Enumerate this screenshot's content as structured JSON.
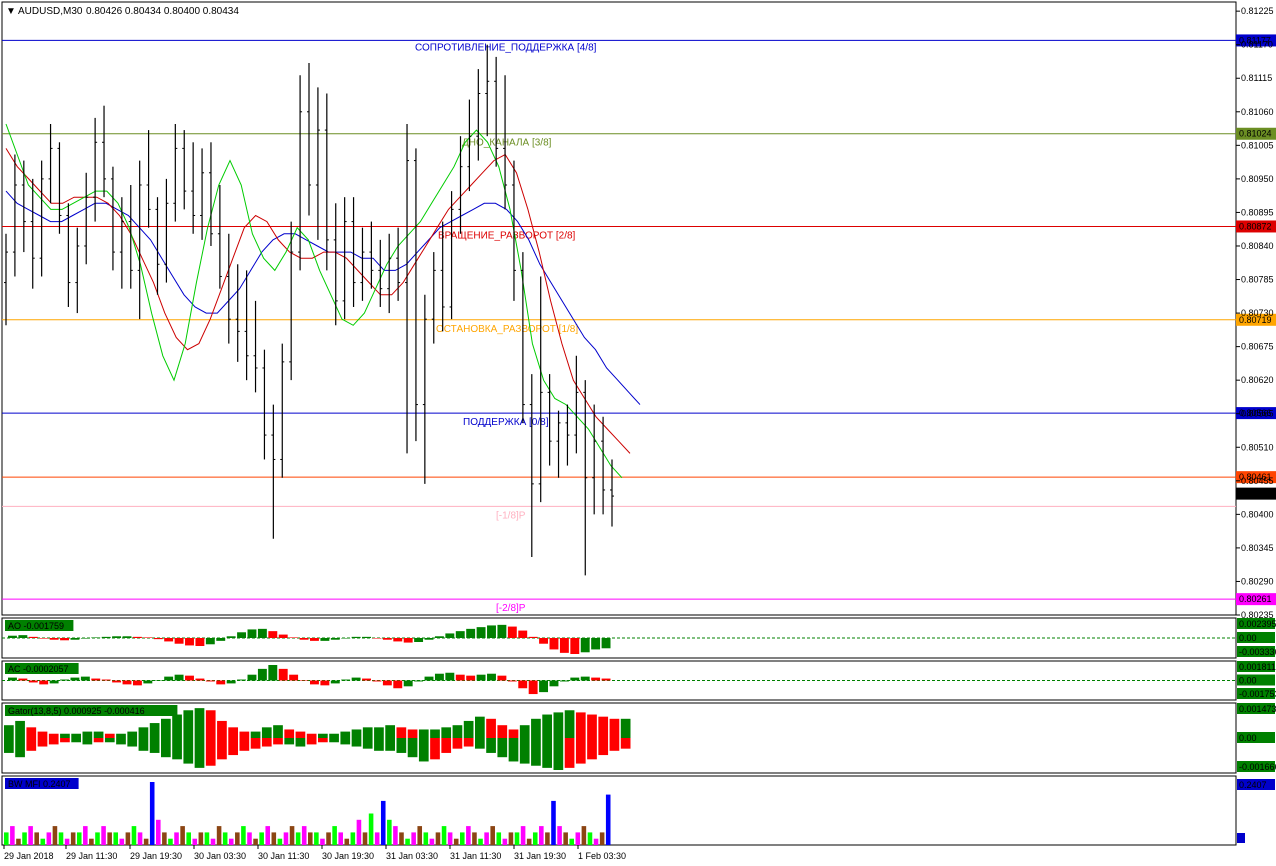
{
  "header": {
    "symbol_tf": "AUDUSD,M30",
    "ohlc": "0.80426 0.80434 0.80400 0.80434"
  },
  "colors": {
    "frame": "#000000",
    "candle": "#000000",
    "jaw": "#0000cc",
    "teeth": "#cc0000",
    "lips": "#00cc00",
    "up_bar": "#008000",
    "down_bar": "#ff0000",
    "fractal": "#000000"
  },
  "chart_data": [
    {
      "type": "candlestick",
      "name": "main",
      "ylim": [
        0.80235,
        0.8124
      ],
      "y_ticks": [
        "0.81225",
        "0.81170",
        "0.81115",
        "0.81060",
        "0.81005",
        "0.80950",
        "0.80895",
        "0.80840",
        "0.80785",
        "0.80730",
        "0.80675",
        "0.80620",
        "0.80565",
        "0.80510",
        "0.80455",
        "0.80400",
        "0.80345",
        "0.80290",
        "0.80235"
      ],
      "x_ticks": [
        "29 Jan 2018",
        "29 Jan 11:30",
        "29 Jan 19:30",
        "30 Jan 03:30",
        "30 Jan 11:30",
        "30 Jan 19:30",
        "31 Jan 03:30",
        "31 Jan 11:30",
        "31 Jan 19:30",
        "1 Feb 03:30"
      ],
      "current_price": "0.80434",
      "murrey_levels": [
        {
          "label": "СОПРОТИВЛЕНИЕ_ПОДДЕРЖКА [4/8]",
          "value": 0.81177,
          "price": "0.81177",
          "color": "#0000cc"
        },
        {
          "label": "ДНО_КАНАЛА [3/8]",
          "value": 0.81024,
          "price": "0.81024",
          "color": "#6b8e23"
        },
        {
          "label": "ВРАЩЕНИЕ_РАЗВОРОТ [2/8]",
          "value": 0.80872,
          "price": "0.80872",
          "color": "#dd0000"
        },
        {
          "label": "ОСТАНОВКА_РАЗВОРОТ [1/8]",
          "value": 0.80719,
          "price": "0.80719",
          "color": "#ffa500"
        },
        {
          "label": "ПОДДЕРЖКА [0/8]",
          "value": 0.80566,
          "price": "0.80566",
          "color": "#0000cc"
        },
        {
          "label": "",
          "value": 0.80461,
          "price": "0.80461",
          "color": "#ff4500"
        },
        {
          "label": "[-1/8]P",
          "value": 0.80413,
          "price": "",
          "color": "#ffb0c0"
        },
        {
          "label": "[-2/8]P",
          "value": 0.80261,
          "price": "0.80261",
          "color": "#ff00ff"
        }
      ],
      "candles": [
        [
          0.8078,
          0.8086,
          0.8071,
          0.8083
        ],
        [
          0.8083,
          0.8099,
          0.8079,
          0.8094
        ],
        [
          0.8094,
          0.8098,
          0.8083,
          0.8088
        ],
        [
          0.8088,
          0.8095,
          0.8077,
          0.8082
        ],
        [
          0.8082,
          0.8098,
          0.8079,
          0.8095
        ],
        [
          0.8095,
          0.8104,
          0.8091,
          0.81
        ],
        [
          0.81,
          0.8101,
          0.8086,
          0.8089
        ],
        [
          0.8089,
          0.8091,
          0.8074,
          0.8078
        ],
        [
          0.8078,
          0.8087,
          0.8073,
          0.8084
        ],
        [
          0.8084,
          0.8096,
          0.8081,
          0.8092
        ],
        [
          0.8092,
          0.8105,
          0.8088,
          0.8101
        ],
        [
          0.8101,
          0.8107,
          0.8092,
          0.8095
        ],
        [
          0.8095,
          0.8097,
          0.808,
          0.8083
        ],
        [
          0.8083,
          0.8092,
          0.8077,
          0.8088
        ],
        [
          0.8088,
          0.8094,
          0.8077,
          0.808
        ],
        [
          0.808,
          0.8098,
          0.8072,
          0.8094
        ],
        [
          0.8094,
          0.8103,
          0.8087,
          0.809
        ],
        [
          0.809,
          0.8092,
          0.8076,
          0.8081
        ],
        [
          0.8081,
          0.8095,
          0.8078,
          0.8091
        ],
        [
          0.8091,
          0.8104,
          0.8088,
          0.81
        ],
        [
          0.81,
          0.8103,
          0.809,
          0.8093
        ],
        [
          0.8093,
          0.8101,
          0.8086,
          0.8089
        ],
        [
          0.8089,
          0.81,
          0.8085,
          0.8096
        ],
        [
          0.8096,
          0.8101,
          0.8084,
          0.8086
        ],
        [
          0.8086,
          0.8094,
          0.8077,
          0.8079
        ],
        [
          0.8079,
          0.8086,
          0.8068,
          0.8072
        ],
        [
          0.8072,
          0.8081,
          0.8065,
          0.807
        ],
        [
          0.807,
          0.808,
          0.8062,
          0.8066
        ],
        [
          0.8066,
          0.8075,
          0.806,
          0.8064
        ],
        [
          0.8064,
          0.8067,
          0.8049,
          0.8053
        ],
        [
          0.8053,
          0.8058,
          0.8036,
          0.8049
        ],
        [
          0.8049,
          0.8068,
          0.8046,
          0.8065
        ],
        [
          0.8065,
          0.8088,
          0.8062,
          0.8083
        ],
        [
          0.8083,
          0.8112,
          0.808,
          0.8106
        ],
        [
          0.8106,
          0.8114,
          0.8089,
          0.8094
        ],
        [
          0.8094,
          0.811,
          0.8085,
          0.8103
        ],
        [
          0.8103,
          0.8109,
          0.808,
          0.8085
        ],
        [
          0.8085,
          0.8091,
          0.8071,
          0.8075
        ],
        [
          0.8075,
          0.8092,
          0.8072,
          0.8088
        ],
        [
          0.8088,
          0.8092,
          0.8074,
          0.8078
        ],
        [
          0.8078,
          0.8087,
          0.8075,
          0.8083
        ],
        [
          0.8083,
          0.8088,
          0.8077,
          0.808
        ],
        [
          0.808,
          0.8085,
          0.8074,
          0.8077
        ],
        [
          0.8077,
          0.8086,
          0.8073,
          0.8082
        ],
        [
          0.8082,
          0.8087,
          0.8075,
          0.8078
        ],
        [
          0.8078,
          0.8104,
          0.805,
          0.8098
        ],
        [
          0.8098,
          0.81,
          0.8052,
          0.8058
        ],
        [
          0.8058,
          0.8076,
          0.8045,
          0.8072
        ],
        [
          0.8072,
          0.8083,
          0.8068,
          0.808
        ],
        [
          0.808,
          0.8088,
          0.807,
          0.8074
        ],
        [
          0.8074,
          0.8093,
          0.8072,
          0.809
        ],
        [
          0.809,
          0.8102,
          0.8086,
          0.8097
        ],
        [
          0.8097,
          0.8108,
          0.8093,
          0.8102
        ],
        [
          0.8102,
          0.8113,
          0.8098,
          0.8109
        ],
        [
          0.8109,
          0.8117,
          0.8102,
          0.8111
        ],
        [
          0.8111,
          0.8115,
          0.8097,
          0.81
        ],
        [
          0.81,
          0.8112,
          0.809,
          0.8094
        ],
        [
          0.8094,
          0.8098,
          0.8075,
          0.808
        ],
        [
          0.808,
          0.8083,
          0.8055,
          0.8058
        ],
        [
          0.8058,
          0.8063,
          0.8033,
          0.8045
        ],
        [
          0.8045,
          0.8079,
          0.8042,
          0.806
        ],
        [
          0.806,
          0.8063,
          0.8048,
          0.8052
        ],
        [
          0.8052,
          0.8057,
          0.8046,
          0.8055
        ],
        [
          0.8055,
          0.8058,
          0.8048,
          0.8053
        ],
        [
          0.8053,
          0.8066,
          0.805,
          0.806
        ],
        [
          0.806,
          0.8062,
          0.803,
          0.8046
        ],
        [
          0.8046,
          0.8058,
          0.804,
          0.8052
        ],
        [
          0.8052,
          0.8056,
          0.804,
          0.8044
        ],
        [
          0.8044,
          0.8049,
          0.8038,
          0.8043
        ]
      ],
      "alligator": {
        "jaw": [
          0.8093,
          0.8091,
          0.809,
          0.8089,
          0.8088,
          0.8088,
          0.8089,
          0.809,
          0.8091,
          0.8091,
          0.809,
          0.8089,
          0.8087,
          0.8085,
          0.8082,
          0.8079,
          0.8076,
          0.8074,
          0.8073,
          0.8073,
          0.8075,
          0.8077,
          0.808,
          0.8083,
          0.8085,
          0.8086,
          0.8086,
          0.8085,
          0.8084,
          0.8083,
          0.8083,
          0.8083,
          0.8082,
          0.8082,
          0.808,
          0.808,
          0.8081,
          0.8083,
          0.8085,
          0.8087,
          0.8088,
          0.8089,
          0.809,
          0.8091,
          0.8091,
          0.809,
          0.8088,
          0.8085,
          0.8081,
          0.8078,
          0.8075,
          0.8072,
          0.8069,
          0.8067,
          0.8064,
          0.8062,
          0.806,
          0.8058
        ],
        "teeth": [
          0.81,
          0.8097,
          0.8095,
          0.8093,
          0.8091,
          0.8091,
          0.8092,
          0.8092,
          0.8092,
          0.8091,
          0.8089,
          0.8086,
          0.8082,
          0.8078,
          0.8073,
          0.8069,
          0.8067,
          0.8068,
          0.8072,
          0.8077,
          0.8082,
          0.8087,
          0.8089,
          0.8088,
          0.8085,
          0.8083,
          0.8082,
          0.8082,
          0.8083,
          0.8083,
          0.8082,
          0.808,
          0.8078,
          0.8076,
          0.8076,
          0.8078,
          0.8081,
          0.8084,
          0.8087,
          0.809,
          0.8092,
          0.8094,
          0.8096,
          0.8098,
          0.8099,
          0.8096,
          0.809,
          0.8083,
          0.8075,
          0.8068,
          0.8062,
          0.8059,
          0.8056,
          0.8054,
          0.8052,
          0.805
        ],
        "lips": [
          0.8104,
          0.8099,
          0.8094,
          0.8092,
          0.809,
          0.809,
          0.8091,
          0.8092,
          0.8093,
          0.8093,
          0.8091,
          0.8087,
          0.8081,
          0.8073,
          0.8066,
          0.8062,
          0.8068,
          0.8078,
          0.8087,
          0.8094,
          0.8098,
          0.8094,
          0.8086,
          0.8082,
          0.808,
          0.8083,
          0.8087,
          0.8085,
          0.808,
          0.8076,
          0.8072,
          0.8071,
          0.8073,
          0.8077,
          0.8081,
          0.8084,
          0.8086,
          0.8088,
          0.8091,
          0.8094,
          0.8097,
          0.8101,
          0.8103,
          0.8101,
          0.8097,
          0.809,
          0.808,
          0.8068,
          0.8062,
          0.8059,
          0.8058,
          0.8056,
          0.8054,
          0.8051,
          0.8048,
          0.8046
        ]
      }
    },
    {
      "type": "histogram",
      "name": "ao",
      "label": "AO -0.001759",
      "y_ticks": [
        "0.002395",
        "0.00",
        "-0.003336"
      ],
      "values": [
        0.4,
        0.5,
        0.2,
        -0.1,
        -0.3,
        -0.4,
        -0.3,
        -0.1,
        0.1,
        0.2,
        0.3,
        0.3,
        0.2,
        0.1,
        -0.2,
        -0.6,
        -1.0,
        -1.3,
        -1.4,
        -1.1,
        -0.5,
        0.3,
        1.0,
        1.5,
        1.6,
        1.2,
        0.6,
        0.1,
        -0.3,
        -0.5,
        -0.5,
        -0.3,
        0.0,
        0.2,
        0.2,
        0.0,
        -0.3,
        -0.6,
        -0.8,
        -0.7,
        -0.3,
        0.3,
        0.8,
        1.2,
        1.6,
        1.9,
        2.2,
        2.3,
        2.0,
        1.3,
        0.2,
        -1.0,
        -2.0,
        -2.6,
        -2.8,
        -2.5,
        -2.0,
        -1.8
      ]
    },
    {
      "type": "histogram",
      "name": "ac",
      "label": "AC -0.0002057",
      "y_ticks": [
        "0.001811",
        "0.00",
        "-0.001753"
      ],
      "values": [
        0.3,
        0.2,
        -0.2,
        -0.4,
        -0.3,
        0.1,
        0.3,
        0.4,
        0.2,
        0.1,
        -0.2,
        -0.4,
        -0.5,
        -0.3,
        0.0,
        0.4,
        0.6,
        0.5,
        0.2,
        -0.1,
        -0.4,
        -0.3,
        0.1,
        0.6,
        1.2,
        1.6,
        1.2,
        0.6,
        0.0,
        -0.4,
        -0.5,
        -0.3,
        0.1,
        0.3,
        0.2,
        -0.1,
        -0.5,
        -0.8,
        -0.6,
        -0.1,
        0.4,
        0.7,
        0.8,
        0.6,
        0.5,
        0.6,
        0.7,
        0.5,
        -0.1,
        -0.8,
        -1.4,
        -1.2,
        -0.6,
        -0.1,
        0.3,
        0.4,
        0.3,
        0.2
      ]
    },
    {
      "type": "histogram",
      "name": "gator",
      "label": "Gator(13,8,5) 0.000925 -0.000416",
      "y_ticks": [
        "0.001473",
        "0.00",
        "-0.001666"
      ],
      "upper": [
        0.6,
        0.8,
        0.5,
        0.3,
        0.2,
        0.2,
        0.2,
        0.3,
        0.3,
        0.2,
        0.2,
        0.3,
        0.5,
        0.7,
        0.9,
        1.1,
        1.3,
        1.4,
        1.3,
        0.8,
        0.5,
        0.3,
        0.3,
        0.5,
        0.6,
        0.4,
        0.3,
        0.2,
        0.2,
        0.2,
        0.3,
        0.4,
        0.5,
        0.5,
        0.6,
        0.5,
        0.4,
        0.4,
        0.4,
        0.5,
        0.6,
        0.8,
        1.0,
        0.9,
        0.6,
        0.4,
        0.6,
        0.9,
        1.1,
        1.2,
        1.3,
        1.2,
        1.1,
        1.0,
        0.9,
        0.9
      ],
      "lower": [
        -0.7,
        -0.9,
        -0.6,
        -0.4,
        -0.3,
        -0.2,
        -0.2,
        -0.3,
        -0.2,
        -0.2,
        -0.3,
        -0.4,
        -0.6,
        -0.7,
        -0.9,
        -1.0,
        -1.2,
        -1.4,
        -1.3,
        -1.0,
        -0.8,
        -0.6,
        -0.5,
        -0.4,
        -0.3,
        -0.3,
        -0.4,
        -0.3,
        -0.2,
        -0.2,
        -0.3,
        -0.4,
        -0.5,
        -0.6,
        -0.6,
        -0.7,
        -0.9,
        -1.1,
        -1.0,
        -0.7,
        -0.5,
        -0.4,
        -0.5,
        -0.7,
        -0.9,
        -1.1,
        -1.2,
        -1.3,
        -1.4,
        -1.5,
        -1.4,
        -1.2,
        -1.0,
        -0.8,
        -0.6,
        -0.5
      ]
    },
    {
      "type": "bar",
      "name": "bw_mfi",
      "label": "BW MFI 0.2407",
      "y_ticks": [
        "0.2407"
      ],
      "values": [
        0.2,
        0.3,
        0.1,
        0.2,
        0.3,
        0.2,
        0.1,
        0.2,
        0.3,
        0.2,
        0.1,
        0.2,
        0.2,
        0.3,
        0.1,
        0.2,
        0.3,
        0.2,
        0.2,
        0.1,
        0.2,
        0.3,
        0.2,
        0.1,
        1.0,
        0.4,
        0.2,
        0.1,
        0.2,
        0.3,
        0.2,
        0.1,
        0.2,
        0.2,
        0.1,
        0.3,
        0.2,
        0.1,
        0.2,
        0.3,
        0.2,
        0.1,
        0.2,
        0.3,
        0.2,
        0.1,
        0.2,
        0.3,
        0.2,
        0.3,
        0.2,
        0.2,
        0.1,
        0.2,
        0.3,
        0.2,
        0.1,
        0.2,
        0.4,
        0.2,
        0.5,
        0.2,
        0.7,
        0.4,
        0.3,
        0.2,
        0.1,
        0.2,
        0.3,
        0.2,
        0.1,
        0.2,
        0.3,
        0.2,
        0.1,
        0.2,
        0.3,
        0.2,
        0.1,
        0.2,
        0.3,
        0.2,
        0.1,
        0.2,
        0.2,
        0.3,
        0.1,
        0.2,
        0.3,
        0.2,
        0.7,
        0.3,
        0.2,
        0.1,
        0.2,
        0.3,
        0.2,
        0.1,
        0.2,
        0.8
      ]
    }
  ]
}
